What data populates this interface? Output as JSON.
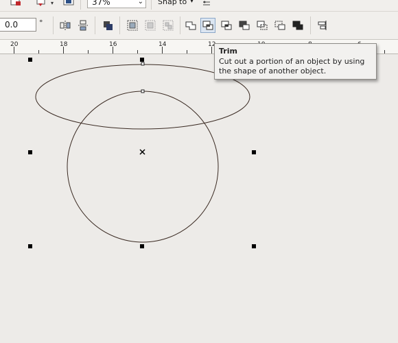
{
  "toolbar_top": {
    "zoom_value": "37%",
    "snap_label": "Snap to"
  },
  "property_bar": {
    "angle_value": "0.0",
    "angle_unit": "°"
  },
  "ruler": {
    "labels": [
      "20",
      "18",
      "16",
      "14",
      "12",
      "10",
      "8",
      "6"
    ]
  },
  "tooltip": {
    "title": "Trim",
    "description": "Cut out a portion of an object by using the shape of another object."
  },
  "icons": {
    "zoom_dropdown": "chevron-down-icon",
    "snap_dropdown": "chevron-down-icon",
    "center_marker": "x-mark-icon"
  }
}
